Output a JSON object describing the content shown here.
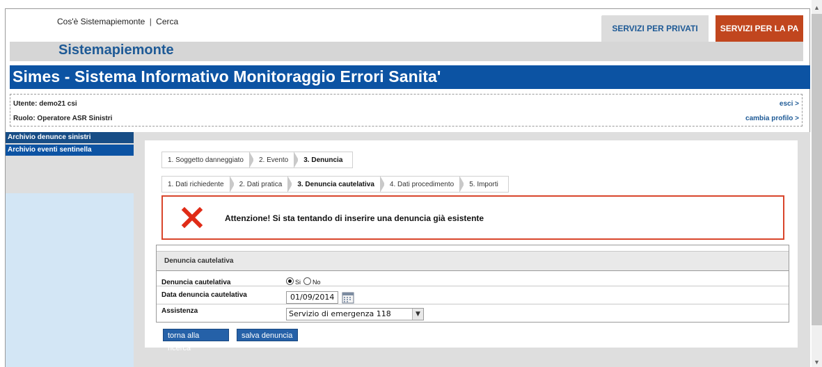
{
  "top_nav": {
    "link_about": "Cos'è Sistemapiemonte",
    "separator": "|",
    "link_search": "Cerca",
    "btn_privati": "SERVIZI PER PRIVATI",
    "btn_pa": "SERVIZI PER LA PA"
  },
  "brand": {
    "title": "Sistemapiemonte"
  },
  "app": {
    "title": "Simes - Sistema Informativo Monitoraggio Errori Sanita'"
  },
  "user": {
    "utente": "Utente: demo21 csi",
    "ruolo": "Ruolo: Operatore ASR Sinistri",
    "esci": "esci >",
    "cambia_profilo": "cambia profilo >"
  },
  "sidebar": {
    "items": [
      {
        "label": "Archivio denunce sinistri"
      },
      {
        "label": "Archivio eventi sentinella"
      }
    ]
  },
  "steps_main": [
    {
      "label": "1. Soggetto danneggiato"
    },
    {
      "label": "2. Evento"
    },
    {
      "label": "3. Denuncia"
    }
  ],
  "steps_sub": [
    {
      "label": "1. Dati richiedente"
    },
    {
      "label": "2. Dati pratica"
    },
    {
      "label": "3. Denuncia cautelativa"
    },
    {
      "label": "4. Dati procedimento"
    },
    {
      "label": "5. Importi"
    }
  ],
  "alert": {
    "message": "Attenzione! Si sta tentando di inserire una denuncia già esistente",
    "icon": "error-x-icon",
    "color": "#d9452b"
  },
  "form": {
    "section_title": "Denuncia cautelativa",
    "field_cautelativa_label": "Denuncia cautelativa",
    "radio_si": "Si",
    "radio_no": "No",
    "radio_selected": "Si",
    "field_data_label": "Data denuncia cautelativa",
    "field_data_value": "01/09/2014",
    "field_assistenza_label": "Assistenza",
    "field_assistenza_value": "Servizio di emergenza 118"
  },
  "actions": {
    "torna": "torna alla ricerca",
    "salva": "salva denuncia"
  },
  "colors": {
    "brand_blue": "#0c53a3",
    "pa_orange": "#c1461e",
    "link_blue": "#1e5a96"
  }
}
